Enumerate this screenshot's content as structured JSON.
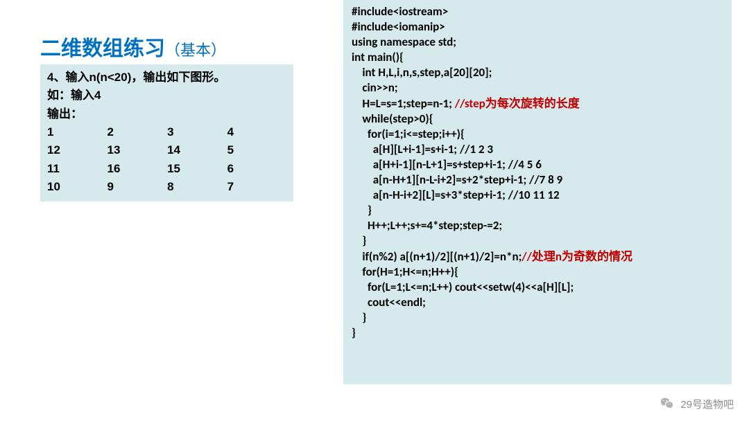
{
  "title": {
    "main": "二维数组练习",
    "sub": "（基本）"
  },
  "problem": {
    "stmt1": "4、输入n(n<20)，输出如下图形。",
    "stmt2": "如：输入4",
    "stmt3": "输出：",
    "grid": [
      [
        "1",
        "2",
        "3",
        "4"
      ],
      [
        "12",
        "13",
        "14",
        "5"
      ],
      [
        "11",
        "16",
        "15",
        "6"
      ],
      [
        "10",
        "9",
        "8",
        "7"
      ]
    ]
  },
  "code": {
    "l01": "#include<iostream>",
    "l02": "#include<iomanip>",
    "l03": "using namespace std;",
    "l04": "int main(){",
    "l05": "    int H,L,i,n,s,step,a[20][20];",
    "l06": "    cin>>n;",
    "l07a": "    H=L=s=1;step=n-1; ",
    "l07b": "//step为每次旋转的长度",
    "l08": "    while(step>0){",
    "l09": "      for(i=1;i<=step;i++){",
    "l10": "        a[H][L+i-1]=s+i-1; //1 2 3",
    "l11": "        a[H+i-1][n-L+1]=s+step+i-1; //4 5 6",
    "l12": "        a[n-H+1][n-L-i+2]=s+2*step+i-1; //7 8 9",
    "l13": "        a[n-H-i+2][L]=s+3*step+i-1; //10 11 12",
    "l14": "      }",
    "l15": "      H++;L++;s+=4*step;step-=2;",
    "l16": "    }",
    "l17a": "    if(n%2) a[(n+1)/2][(n+1)/2]=n*n;",
    "l17b": "//处理n为奇数的情况",
    "l18": "    for(H=1;H<=n;H++){",
    "l19": "      for(L=1;L<=n;L++) cout<<setw(4)<<a[H][L];",
    "l20": "      cout<<endl;",
    "l21": "    }",
    "l22": "}"
  },
  "footer": {
    "label": "29号造物吧"
  }
}
